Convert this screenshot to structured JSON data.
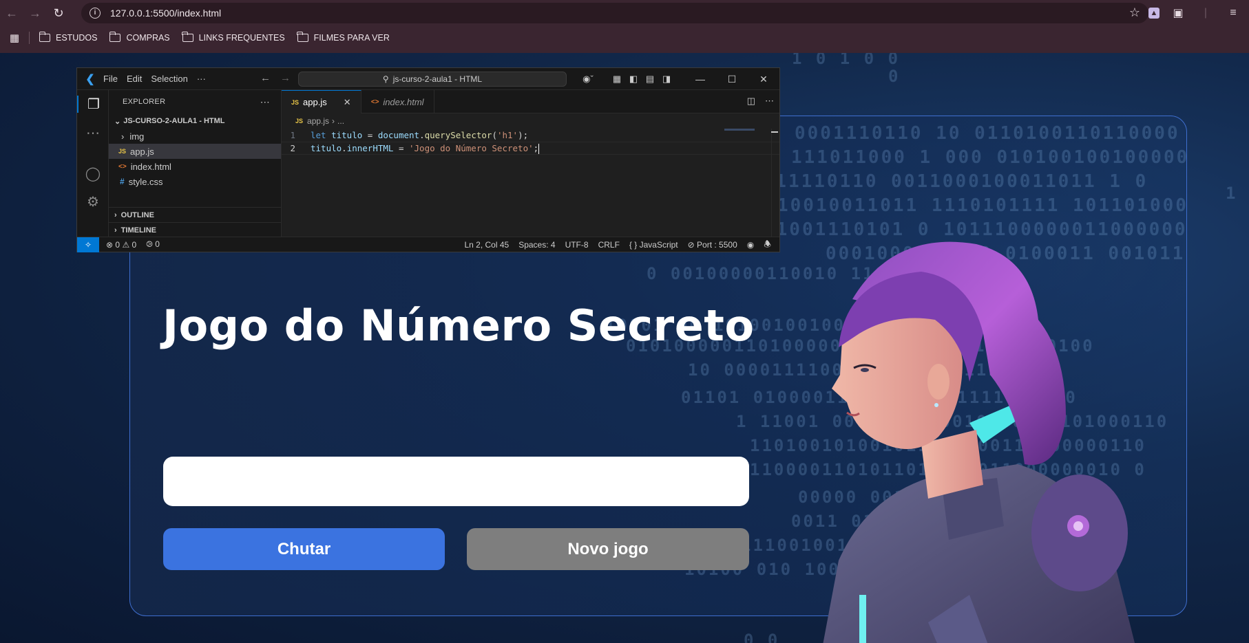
{
  "browser": {
    "url": "127.0.0.1:5500/index.html",
    "bookmarks": [
      "ESTUDOS",
      "COMPRAS",
      "LINKS FREQUENTES",
      "FILMES PARA VER"
    ]
  },
  "page": {
    "title": "Jogo do Número Secreto",
    "input_value": "",
    "buttons": {
      "guess": "Chutar",
      "new_game": "Novo jogo"
    },
    "colors": {
      "guess_button": "#3b73e0",
      "new_game_button": "#7e7e7e",
      "card_border": "#3f6fd0"
    }
  },
  "vscode": {
    "menu": [
      "File",
      "Edit",
      "Selection",
      "···"
    ],
    "search": "js-curso-2-aula1 - HTML",
    "explorer": {
      "title": "EXPLORER",
      "root": "JS-CURSO-2-AULA1 - HTML",
      "items": [
        {
          "name": "img",
          "type": "folder"
        },
        {
          "name": "app.js",
          "type": "js",
          "selected": true
        },
        {
          "name": "index.html",
          "type": "html"
        },
        {
          "name": "style.css",
          "type": "css"
        }
      ],
      "sections": [
        "OUTLINE",
        "TIMELINE"
      ]
    },
    "tabs": [
      {
        "label": "app.js",
        "active": true
      },
      {
        "label": "index.html",
        "active": false
      }
    ],
    "breadcrumb": [
      "app.js",
      "..."
    ],
    "code": [
      {
        "num": "1",
        "tokens": [
          [
            "kw",
            "let "
          ],
          [
            "var",
            "titulo"
          ],
          [
            "op",
            " = "
          ],
          [
            "var",
            "document"
          ],
          [
            "op",
            "."
          ],
          [
            "fn",
            "querySelector"
          ],
          [
            "op",
            "("
          ],
          [
            "str",
            "'h1'"
          ],
          [
            "op",
            ");"
          ]
        ]
      },
      {
        "num": "2",
        "tokens": [
          [
            "var",
            "titulo"
          ],
          [
            "op",
            "."
          ],
          [
            "var",
            "innerHTML"
          ],
          [
            "op",
            " = "
          ],
          [
            "str",
            "'Jogo do Número Secreto'"
          ],
          [
            "op",
            ";"
          ]
        ]
      }
    ],
    "status": {
      "errors": "0",
      "warnings": "0",
      "ports": "0",
      "position": "Ln 2, Col 45",
      "spaces": "Spaces: 4",
      "encoding": "UTF-8",
      "eol": "CRLF",
      "language": "JavaScript",
      "port": "Port : 5500"
    }
  }
}
